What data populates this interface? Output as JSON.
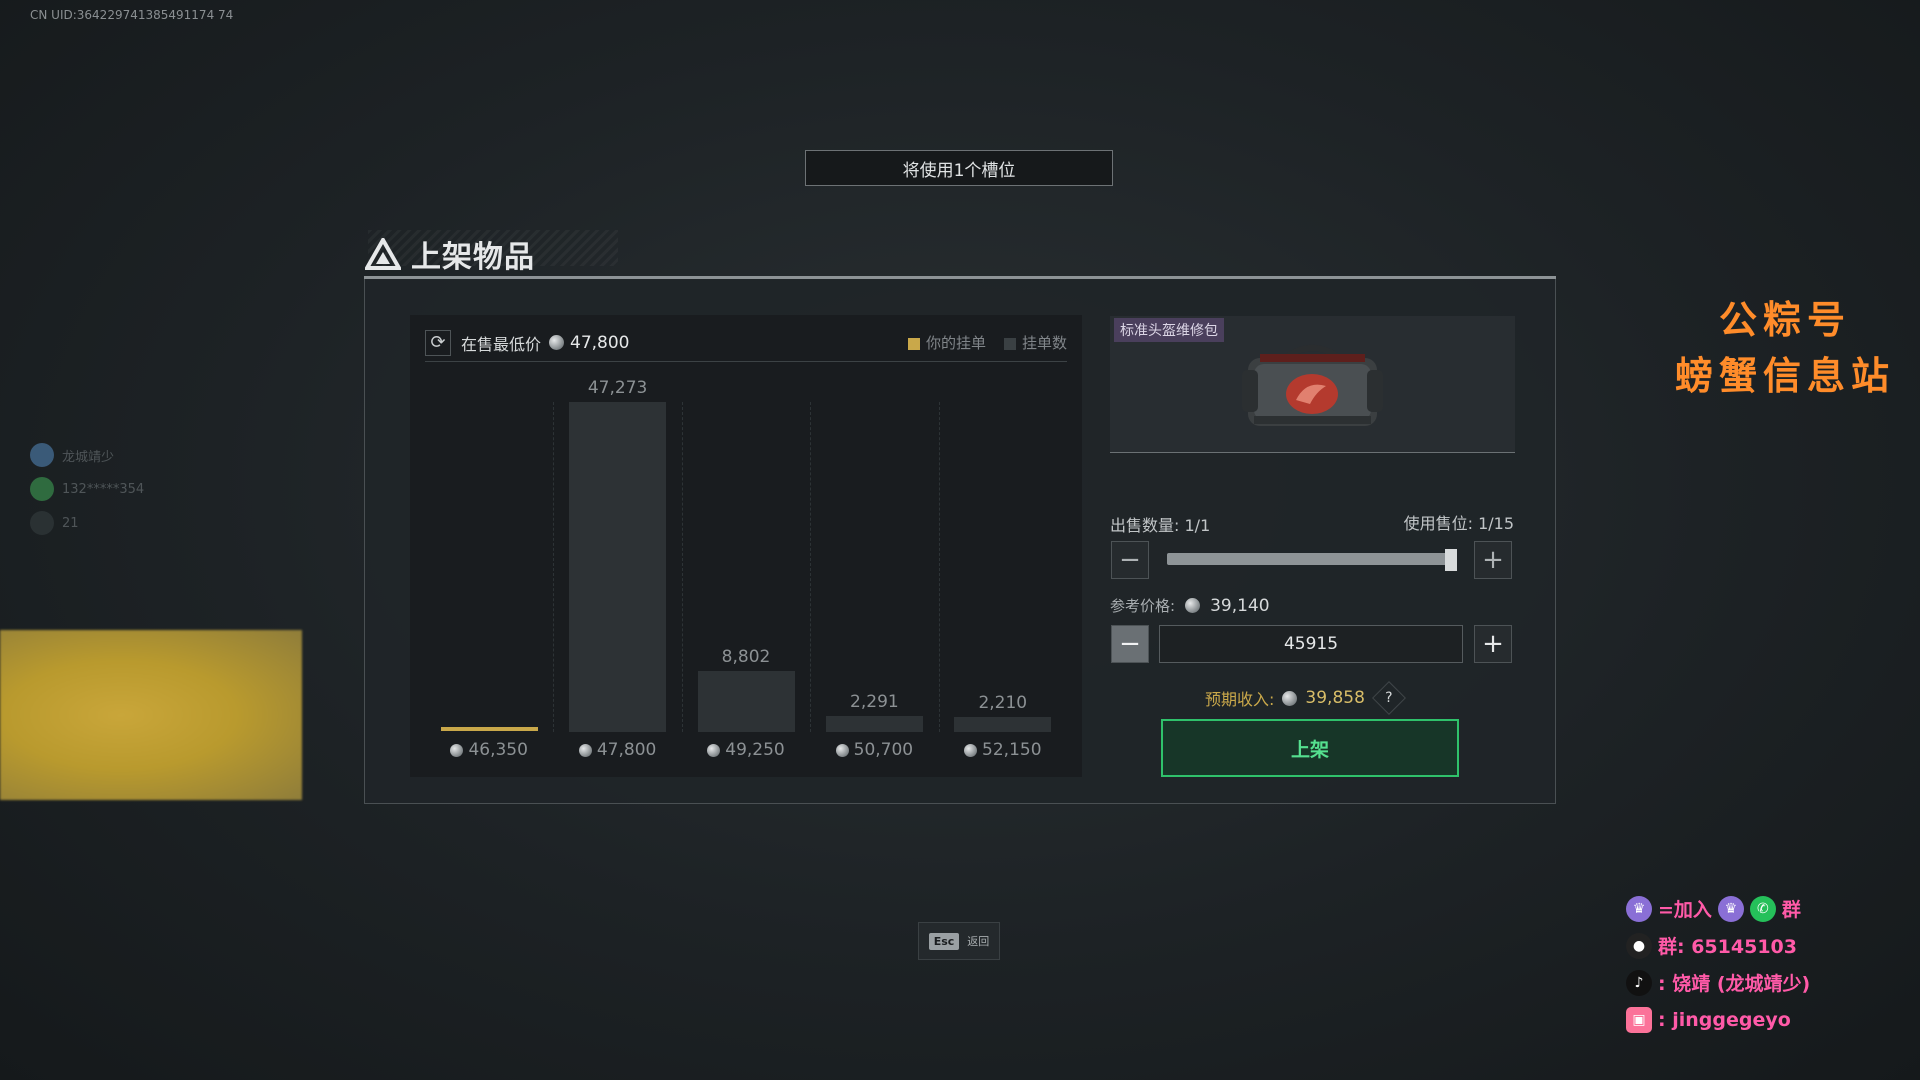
{
  "uid": "CN UID:364229741385491174 74",
  "slot_banner": "将使用1个槽位",
  "page_title": "上架物品",
  "chart_header": {
    "lowest_label": "在售最低价",
    "lowest_value": "47,800",
    "legend_mine": "你的挂单",
    "legend_count": "挂单数"
  },
  "chart_data": {
    "type": "bar",
    "categories": [
      "46,350",
      "47,800",
      "49,250",
      "50,700",
      "52,150"
    ],
    "values": [
      0,
      47273,
      8802,
      2291,
      2210
    ],
    "value_labels": [
      "",
      "47,273",
      "8,802",
      "2,291",
      "2,210"
    ],
    "my_listing_index": 0,
    "colors": {
      "bar": "#2d3235",
      "mine": "#c9a84a"
    }
  },
  "item": {
    "name": "标准头盔维修包"
  },
  "sell": {
    "qty_label": "出售数量:",
    "qty_value": "1/1",
    "slot_label": "使用售位:",
    "slot_value": "1/15",
    "slider_fraction": 1.0,
    "ref_label": "参考价格:",
    "ref_value": "39,140",
    "price_value": "45915",
    "income_label": "预期收入:",
    "income_value": "39,858",
    "help": "?",
    "submit_label": "上架"
  },
  "esc": {
    "key": "Esc",
    "label": "返回"
  },
  "sidebar_users": [
    {
      "name": "龙城靖少",
      "color": "#3a5a78"
    },
    {
      "name": "132*****354",
      "color": "#2f6b3f"
    },
    {
      "name": "21",
      "color": "#2a3133"
    }
  ],
  "watermark": [
    "公粽号",
    "螃蟹信息站"
  ],
  "social": [
    {
      "icon": "trophy-icon",
      "text": "=加入",
      "suffix": "群"
    },
    {
      "icon": "qq-penguin-icon",
      "text": "群: 65145103"
    },
    {
      "icon": "tiktok-icon",
      "text": ": 饶靖 (龙城靖少)"
    },
    {
      "icon": "bilibili-icon",
      "text": ": jinggegeyo"
    }
  ],
  "colors": {
    "accent_green": "#2fc26b",
    "gold": "#c9a84a",
    "watermark_orange": "#ff8c2a",
    "social_pink": "#ff5aa8"
  }
}
